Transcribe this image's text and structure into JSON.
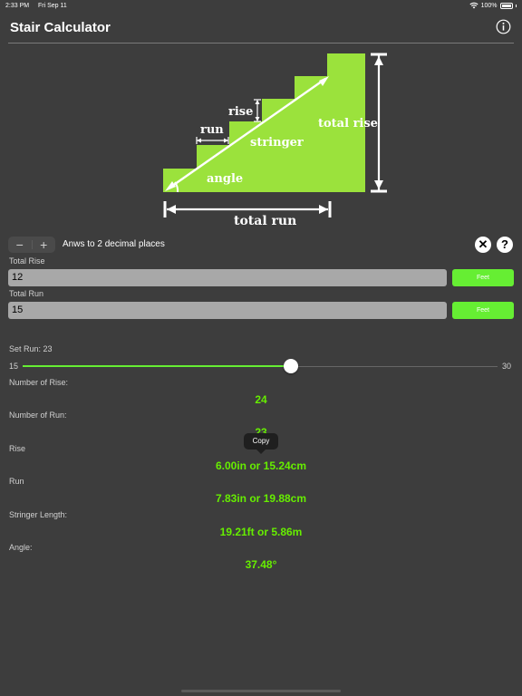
{
  "status": {
    "time": "2:33 PM",
    "day": "Fri Sep 11",
    "battery": "100%"
  },
  "app": {
    "title": "Stair Calculator",
    "info_icon": "info-icon"
  },
  "diagram": {
    "labels": {
      "rise": "rise",
      "run": "run",
      "stringer": "stringer",
      "total_rise": "total rise",
      "angle": "angle",
      "total_run": "total run"
    },
    "colors": {
      "stairs": "#9be23c",
      "arrows": "#ffffff"
    }
  },
  "controls": {
    "minus": "−",
    "plus": "+",
    "decimals_label": "Anws to 2 decimal places",
    "clear_icon": "close-icon",
    "help_icon": "help-icon"
  },
  "inputs": {
    "total_rise": {
      "label": "Total Rise",
      "value": "12",
      "unit": "Feet"
    },
    "total_run": {
      "label": "Total Run",
      "value": "15",
      "unit": "Feet"
    }
  },
  "slider": {
    "label": "Set Run: 23",
    "min": "15",
    "max": "30",
    "value": 23
  },
  "results": {
    "num_rise": {
      "label": "Number of Rise:",
      "value": "24"
    },
    "num_run": {
      "label": "Number of Run:",
      "value": "23"
    },
    "rise": {
      "label": "Rise",
      "value": "6.00in or 15.24cm"
    },
    "run": {
      "label": "Run",
      "value": "7.83in or 19.88cm"
    },
    "stringer": {
      "label": "Stringer Length:",
      "value": "19.21ft or 5.86m"
    },
    "angle": {
      "label": "Angle:",
      "value": "37.48°"
    }
  },
  "tooltip": {
    "copy": "Copy"
  },
  "colors": {
    "accent": "#66ee33",
    "background": "#3d3d3d",
    "result_text": "#66ee00"
  }
}
